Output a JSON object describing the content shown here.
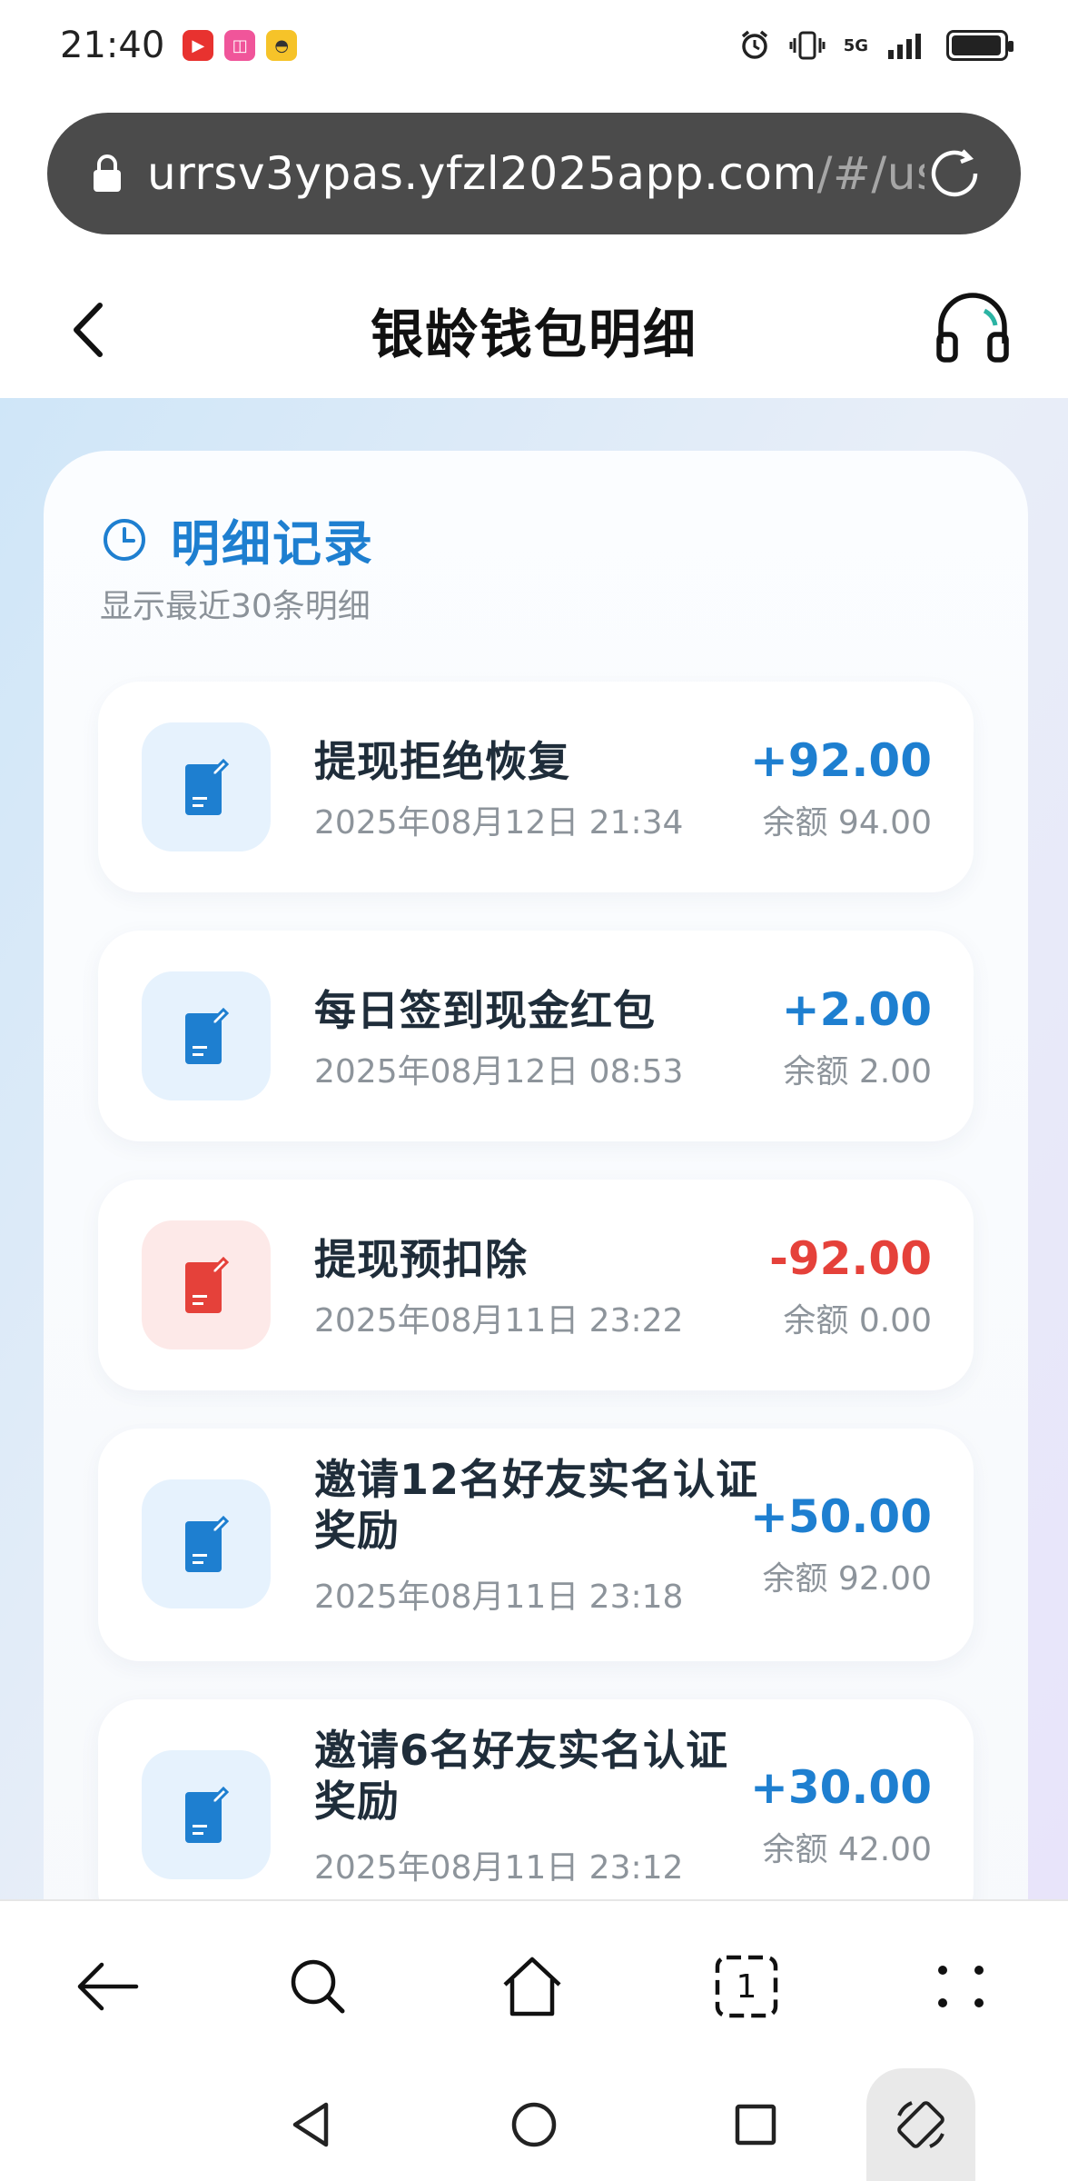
{
  "status_bar": {
    "time": "21:40",
    "network": "5G"
  },
  "url_bar": {
    "domain": "urrsv3ypas.yfzl2025app.com",
    "path": "/#/us"
  },
  "header": {
    "title": "银龄钱包明细"
  },
  "section": {
    "title": "明细记录",
    "subtitle": "显示最近30条明细"
  },
  "records": [
    {
      "title": "提现拒绝恢复",
      "date": "2025年08月12日 21:34",
      "amount": "+92.00",
      "balance": "余额 94.00",
      "type": "income"
    },
    {
      "title": "每日签到现金红包",
      "date": "2025年08月12日 08:53",
      "amount": "+2.00",
      "balance": "余额 2.00",
      "type": "income"
    },
    {
      "title": "提现预扣除",
      "date": "2025年08月11日 23:22",
      "amount": "-92.00",
      "balance": "余额 0.00",
      "type": "expense"
    },
    {
      "title": "邀请12名好友实名认证奖励",
      "date": "2025年08月11日 23:18",
      "amount": "+50.00",
      "balance": "余额 92.00",
      "type": "income"
    },
    {
      "title": "邀请6名好友实名认证奖励",
      "date": "2025年08月11日 23:12",
      "amount": "+30.00",
      "balance": "余额 42.00",
      "type": "income"
    }
  ],
  "browser_nav": {
    "tab_count": "1"
  },
  "colors": {
    "accent": "#1e7fd0",
    "income": "#1e7fd0",
    "expense": "#e5413a",
    "income_bg": "#e6f2fd",
    "expense_bg": "#fde9e8"
  }
}
